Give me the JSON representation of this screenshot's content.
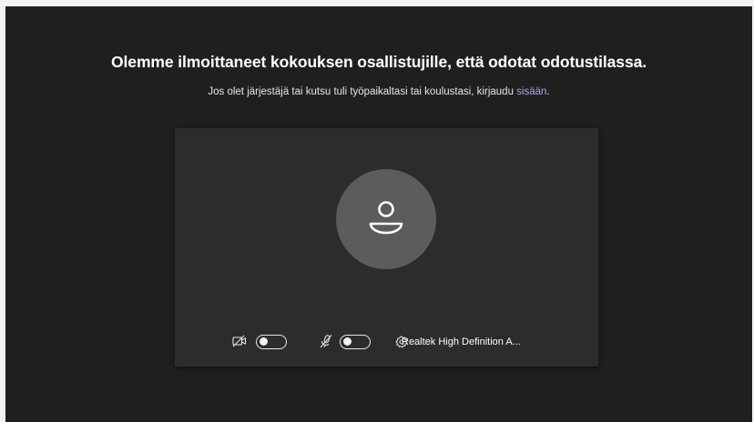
{
  "heading": "Olemme ilmoittaneet kokouksen osallistujille, että odotat odotustilassa.",
  "subtext": {
    "prefix": "Jos olet järjestäjä tai kutsu tuli työpaikaltasi tai koulustasi, kirjaudu ",
    "link": "sisään",
    "suffix": "."
  },
  "controls": {
    "camera_icon": "camera-off-icon",
    "camera_on": false,
    "mic_icon": "mic-off-icon",
    "mic_on": false,
    "device_icon": "gear-icon",
    "device_label": "Realtek High Definition A..."
  },
  "colors": {
    "background": "#1f1f1f",
    "preview": "#2d2c2c",
    "avatar": "#5c5c5c",
    "link": "#a6a7e6"
  }
}
